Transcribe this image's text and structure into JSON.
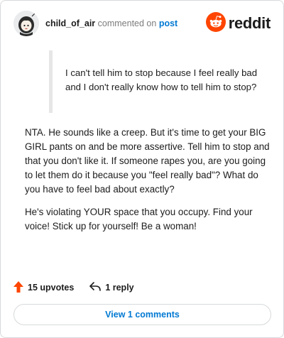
{
  "header": {
    "username": "child_of_air",
    "action_text": "commented on",
    "post_link": "post",
    "brand_name": "reddit",
    "brand_color": "#ff4500"
  },
  "comment": {
    "quote": "I can't tell him to stop because I feel really bad and I don't really know how to tell him to stop?",
    "paragraphs": [
      "NTA. He sounds like a creep. But it's time to get your BIG GIRL pants on and be more assertive. Tell him to stop and that you don't like it. If someone rapes you, are you going to let them do it because you \"feel really bad\"? What do you have to feel bad about exactly?",
      "He's violating YOUR space that you occupy. Find your voice! Stick up for yourself! Be a woman!"
    ]
  },
  "actions": {
    "upvotes_label": "15 upvotes",
    "upvote_icon": "upvote-arrow-icon",
    "upvote_color": "#ff4500",
    "reply_label": "1 reply",
    "reply_icon": "reply-arrow-icon"
  },
  "footer": {
    "view_comments_label": "View 1 comments",
    "link_color": "#0079d3"
  }
}
